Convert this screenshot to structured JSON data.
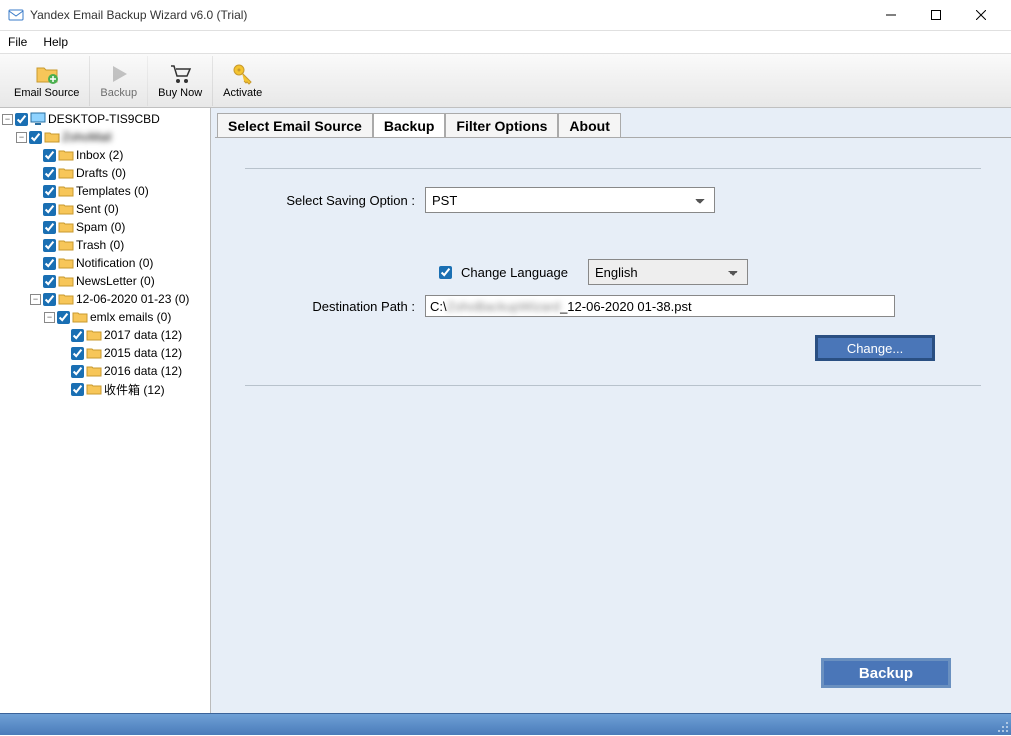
{
  "window": {
    "title": "Yandex Email Backup Wizard v6.0 (Trial)"
  },
  "menu": {
    "file": "File",
    "help": "Help"
  },
  "toolbar": {
    "email_source": "Email Source",
    "backup": "Backup",
    "buy_now": "Buy Now",
    "activate": "Activate"
  },
  "tree": {
    "root": "DESKTOP-TIS9CBD",
    "account_blurred": "ZohoMail",
    "inbox": "Inbox (2)",
    "drafts": "Drafts (0)",
    "templates": "Templates (0)",
    "sent": "Sent (0)",
    "spam": "Spam (0)",
    "trash": "Trash (0)",
    "notification": "Notification (0)",
    "newsletter": "NewsLetter (0)",
    "dated": "12-06-2020 01-23 (0)",
    "emlx": "emlx emails (0)",
    "d2017": "2017 data (12)",
    "d2015": "2015 data (12)",
    "d2016": "2016 data (12)",
    "cjk": "收件箱 (12)"
  },
  "tabs": {
    "t1": "Select Email Source",
    "t2": "Backup",
    "t3": "Filter Options",
    "t4": "About"
  },
  "form": {
    "saving_label": "Select Saving Option :",
    "saving_value": "PST",
    "change_lang_label": "Change Language",
    "lang_value": "English",
    "dest_label": "Destination Path :",
    "dest_prefix": "C:\\",
    "dest_blurred": "ZohoBackupWizard",
    "dest_suffix": "_12-06-2020 01-38.pst",
    "change_btn": "Change...",
    "backup_btn": "Backup"
  }
}
